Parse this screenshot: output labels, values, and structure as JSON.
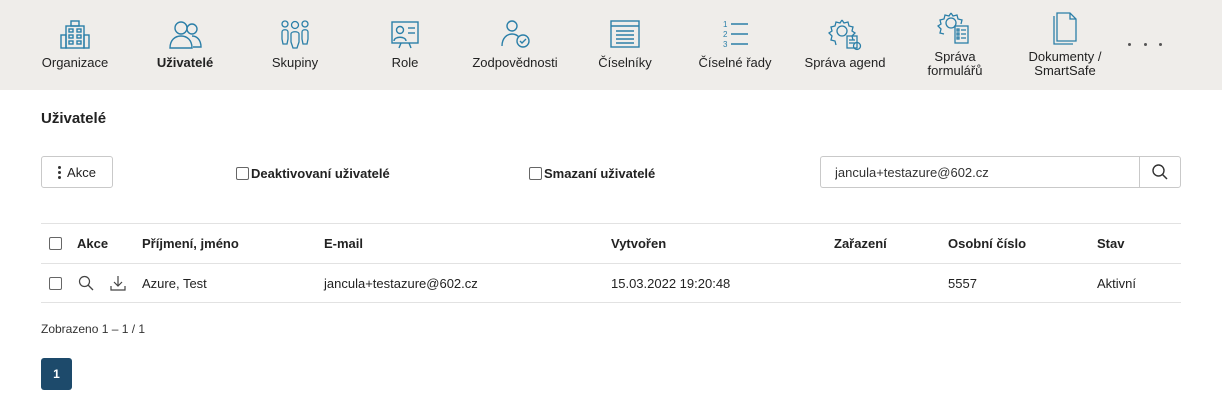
{
  "nav": {
    "items": [
      {
        "label": "Organizace",
        "icon": "building-icon"
      },
      {
        "label": "Uživatelé",
        "icon": "users-icon"
      },
      {
        "label": "Skupiny",
        "icon": "group-icon"
      },
      {
        "label": "Role",
        "icon": "role-card-icon"
      },
      {
        "label": "Zodpovědnosti",
        "icon": "user-check-icon"
      },
      {
        "label": "Číselníky",
        "icon": "list-window-icon"
      },
      {
        "label": "Číselné řady",
        "icon": "numbered-list-icon"
      },
      {
        "label": "Správa agend",
        "icon": "gear-document-icon"
      },
      {
        "label_line1": "Správa",
        "label_line2": "formulářů",
        "icon": "gear-form-icon"
      },
      {
        "label_line1": "Dokumenty /",
        "label_line2": "SmartSafe",
        "icon": "documents-icon"
      }
    ],
    "active": "Uživatelé",
    "more_icon": "more-dots-icon",
    "icon_color": "#2b7fa8"
  },
  "page": {
    "title": "Uživatelé"
  },
  "toolbar": {
    "akce_label": "Akce",
    "deactivated_label": "Deaktivovaní uživatelé",
    "deleted_label": "Smazaní uživatelé",
    "search_value": "jancula+testazure@602.cz"
  },
  "table": {
    "headers": {
      "akce": "Akce",
      "name": "Příjmení, jméno",
      "email": "E-mail",
      "created": "Vytvořen",
      "placement": "Zařazení",
      "personal_number": "Osobní číslo",
      "state": "Stav"
    },
    "rows": [
      {
        "name": "Azure, Test",
        "email": "jancula+testazure@602.cz",
        "created": "15.03.2022 19:20:48",
        "placement": "",
        "personal_number": "5557",
        "state": "Aktivní"
      }
    ]
  },
  "pager": {
    "info": "Zobrazeno 1  – 1  / 1",
    "current_page": "1"
  },
  "colors": {
    "accent": "#1d4a6b",
    "nav_bg": "#efedea"
  }
}
